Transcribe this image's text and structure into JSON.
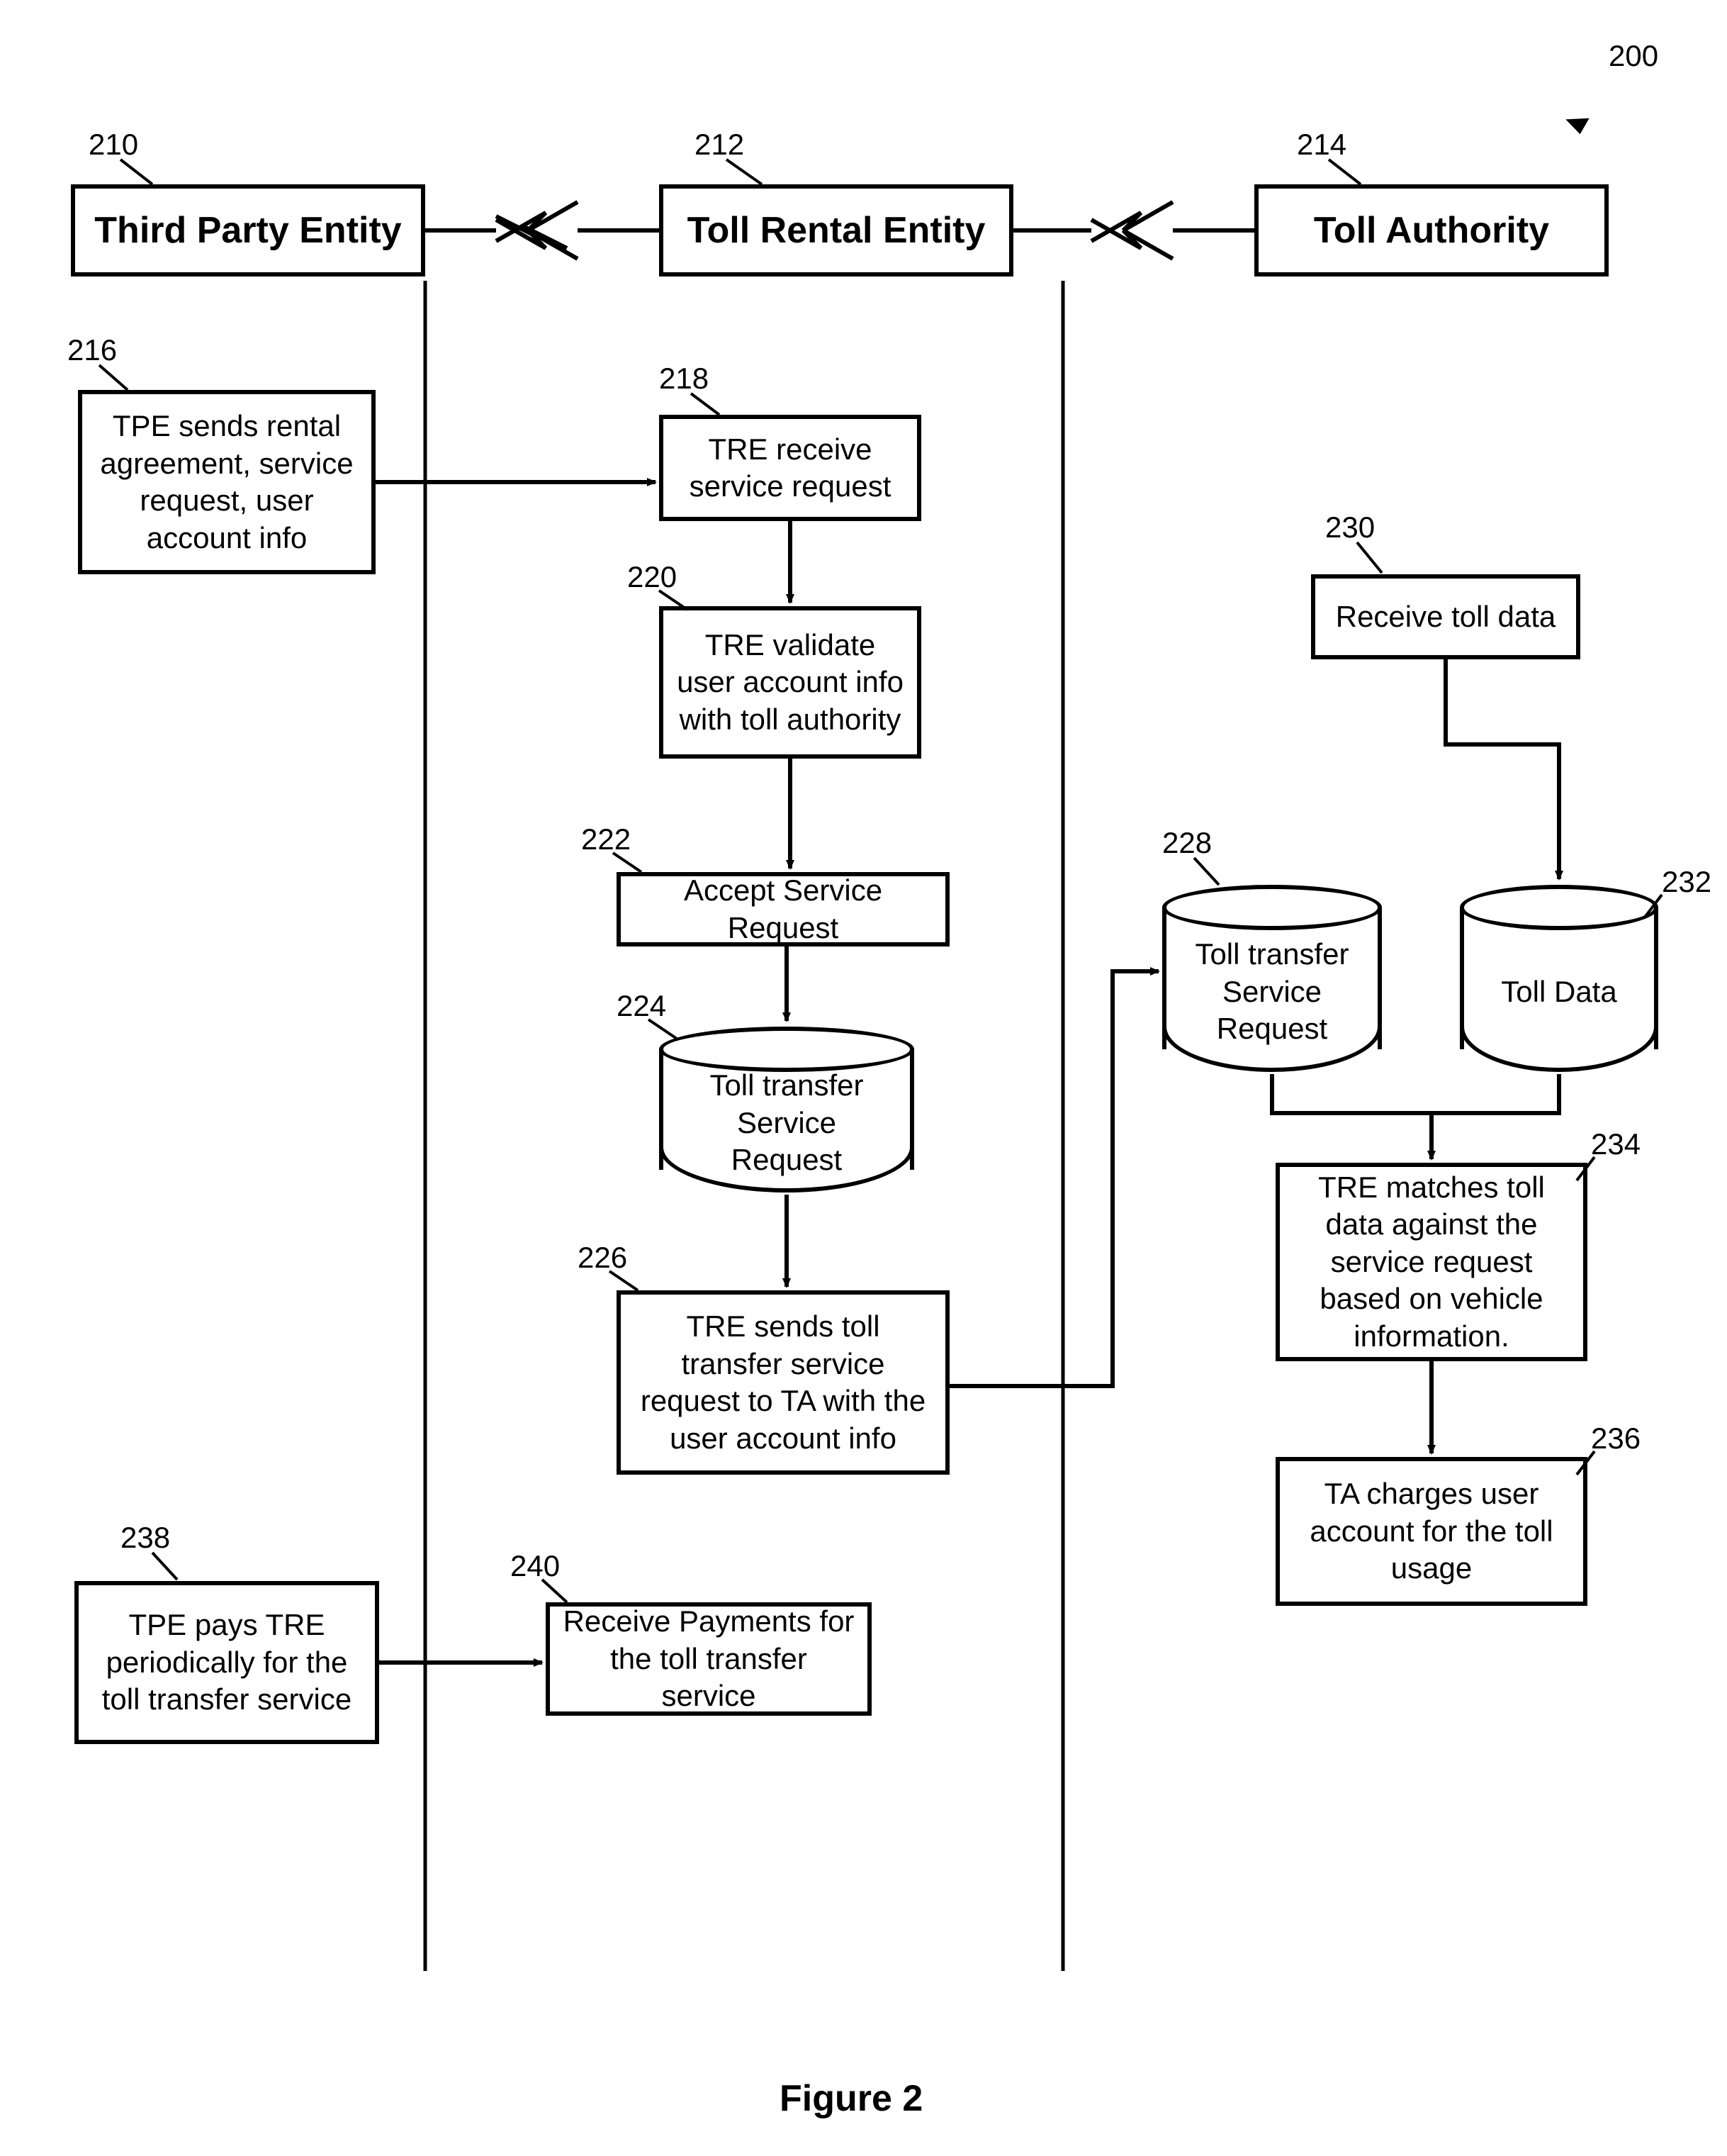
{
  "figure_ref": "200",
  "figure_label": "Figure 2",
  "entities": {
    "tpe": {
      "ref": "210",
      "label": "Third Party Entity"
    },
    "tre": {
      "ref": "212",
      "label": "Toll Rental Entity"
    },
    "ta": {
      "ref": "214",
      "label": "Toll Authority"
    }
  },
  "steps": {
    "s216": {
      "ref": "216",
      "text": "TPE sends rental agreement, service request, user account info"
    },
    "s218": {
      "ref": "218",
      "text": "TRE receive service request"
    },
    "s220": {
      "ref": "220",
      "text": "TRE validate user account info with toll authority"
    },
    "s222": {
      "ref": "222",
      "text": "Accept Service Request"
    },
    "s224": {
      "ref": "224",
      "text": "Toll transfer Service Request"
    },
    "s226": {
      "ref": "226",
      "text": "TRE sends toll transfer service request to TA with the user account info"
    },
    "s228": {
      "ref": "228",
      "text": "Toll transfer Service Request"
    },
    "s230": {
      "ref": "230",
      "text": "Receive toll data"
    },
    "s232": {
      "ref": "232",
      "text": "Toll Data"
    },
    "s234": {
      "ref": "234",
      "text": "TRE matches toll data against the service request based on vehicle information."
    },
    "s236": {
      "ref": "236",
      "text": "TA charges user account for the toll usage"
    },
    "s238": {
      "ref": "238",
      "text": "TPE pays TRE periodically for the toll transfer service"
    },
    "s240": {
      "ref": "240",
      "text": "Receive Payments for the toll transfer service"
    }
  }
}
